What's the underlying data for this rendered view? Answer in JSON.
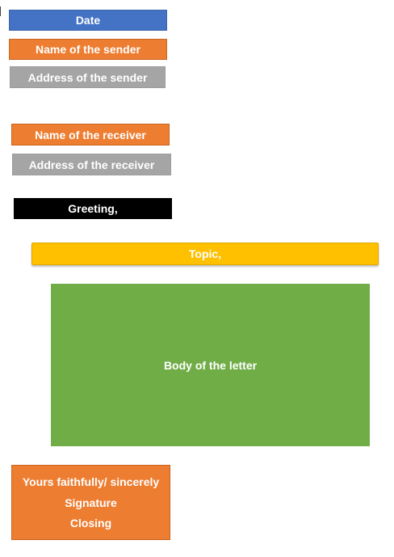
{
  "colors": {
    "date": "#4472c4",
    "sender_name": "#ed7d31",
    "sender_address": "#a5a5a5",
    "receiver_name": "#ed7d31",
    "receiver_address": "#a5a5a5",
    "greeting": "#000000",
    "topic": "#ffc000",
    "body": "#70ad47",
    "closing": "#ed7d31"
  },
  "date": "Date",
  "sender": {
    "name": "Name of the sender",
    "address": "Address of the sender"
  },
  "receiver": {
    "name": "Name of the receiver",
    "address": "Address of the receiver"
  },
  "greeting": "Greeting,",
  "topic": "Topic,",
  "body": "Body of the letter",
  "closing": {
    "line1": "Yours faithfully/ sincerely",
    "line2": "Signature",
    "line3": "Closing"
  }
}
